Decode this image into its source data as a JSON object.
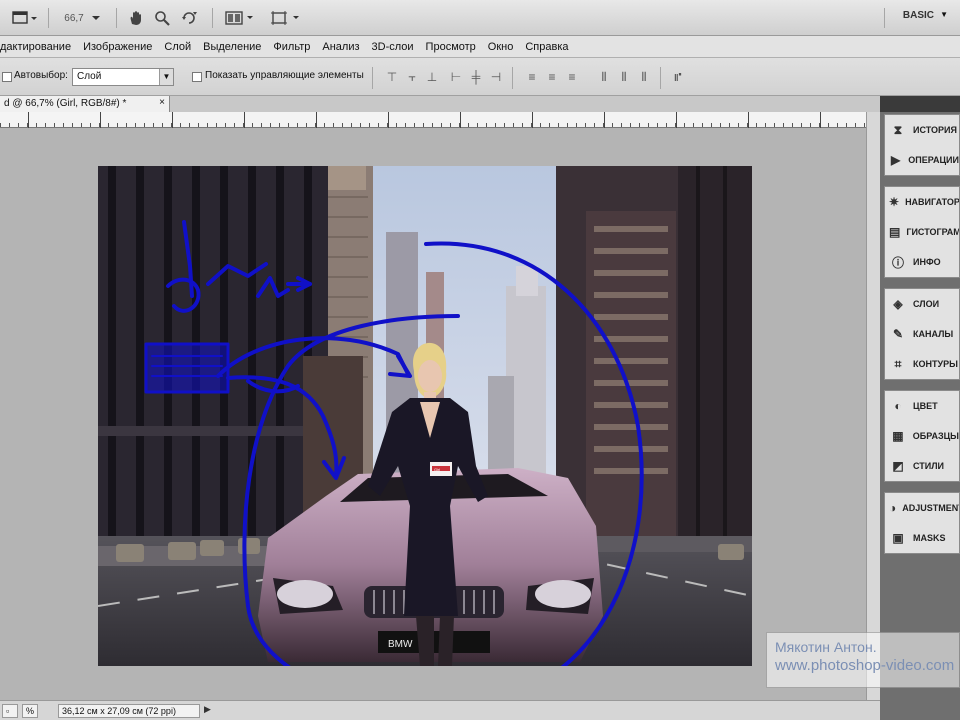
{
  "appbar": {
    "zoom_value": "66,7",
    "workspace_label": "BASIC"
  },
  "menu": {
    "items": [
      "дактирование",
      "Изображение",
      "Слой",
      "Выделение",
      "Фильтр",
      "Анализ",
      "3D-слои",
      "Просмотр",
      "Окно",
      "Справка"
    ]
  },
  "options": {
    "autoselect_label": "Автовыбор:",
    "autoselect_value": "Слой",
    "show_controls_label": "Показать управляющие элементы"
  },
  "document": {
    "tab_title": "d @ 66,7% (Girl, RGB/8#) *",
    "tab_close": "×"
  },
  "statusbar": {
    "zoom": "%",
    "doc_size": "36,12 см x 27,09 см (72 ppi)"
  },
  "panels": {
    "group1": [
      "ИСТОРИЯ",
      "ОПЕРАЦИИ"
    ],
    "group2": [
      "НАВИГАТОР",
      "ГИСТОГРАММА",
      "ИНФО"
    ],
    "group3": [
      "СЛОИ",
      "КАНАЛЫ",
      "КОНТУРЫ"
    ],
    "group4": [
      "ЦВЕТ",
      "ОБРАЗЦЫ",
      "СТИЛИ"
    ],
    "group5": [
      "ADJUSTMENTS",
      "MASKS"
    ]
  },
  "photo": {
    "plate_text": "BMW",
    "badge_text": "Girl"
  },
  "watermark": {
    "author": "Мякотин Антон.",
    "site": "www.photoshop-video.com"
  },
  "colors": {
    "annotation": "#1010c8",
    "car": "#b08aa6"
  }
}
